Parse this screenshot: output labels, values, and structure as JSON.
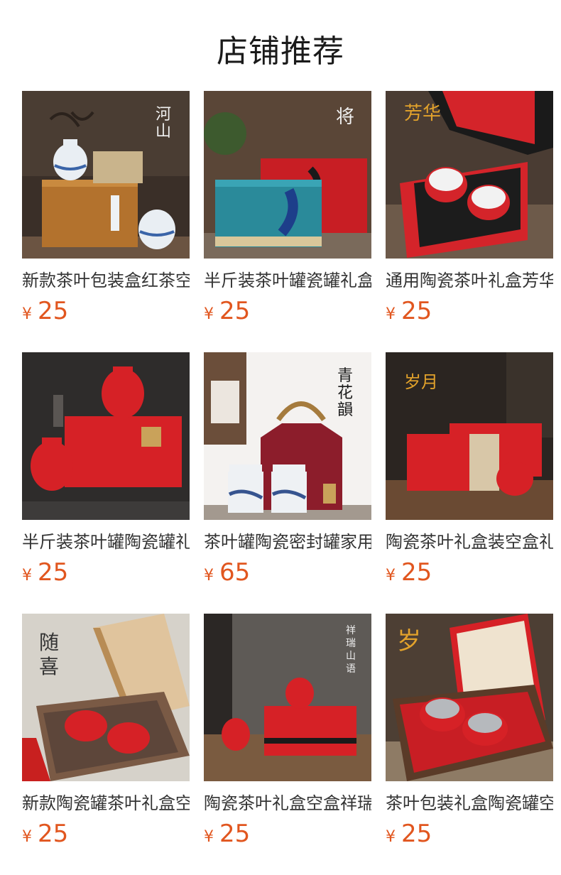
{
  "section": {
    "title": "店铺推荐"
  },
  "products": [
    {
      "name": "新款茶叶包装盒红茶空盒",
      "currency": "¥",
      "price": "25",
      "image": "blue-white-porcelain-jar-wooden-box"
    },
    {
      "name": "半斤装茶叶罐瓷罐礼盒",
      "currency": "¥",
      "price": "25",
      "image": "teal-red-gift-box"
    },
    {
      "name": "通用陶瓷茶叶礼盒芳华",
      "currency": "¥",
      "price": "25",
      "image": "red-box-two-white-jars"
    },
    {
      "name": "半斤装茶叶罐陶瓷罐礼盒",
      "currency": "¥",
      "price": "25",
      "image": "red-jars-red-box"
    },
    {
      "name": "茶叶罐陶瓷密封罐家用",
      "currency": "¥",
      "price": "65",
      "image": "qinghua-jars-burgundy-bag"
    },
    {
      "name": "陶瓷茶叶礼盒装空盒礼品",
      "currency": "¥",
      "price": "25",
      "image": "red-landscape-box-red-jar"
    },
    {
      "name": "新款陶瓷罐茶叶礼盒空盒",
      "currency": "¥",
      "price": "25",
      "image": "open-box-two-red-jars"
    },
    {
      "name": "陶瓷茶叶礼盒空盒祥瑞山语",
      "currency": "¥",
      "price": "25",
      "image": "red-jars-red-gift-box"
    },
    {
      "name": "茶叶包装礼盒陶瓷罐空盒",
      "currency": "¥",
      "price": "25",
      "image": "red-open-box-silver-lids"
    }
  ],
  "colors": {
    "price": "#e1561f",
    "text": "#333333",
    "title": "#1a1a1a"
  }
}
